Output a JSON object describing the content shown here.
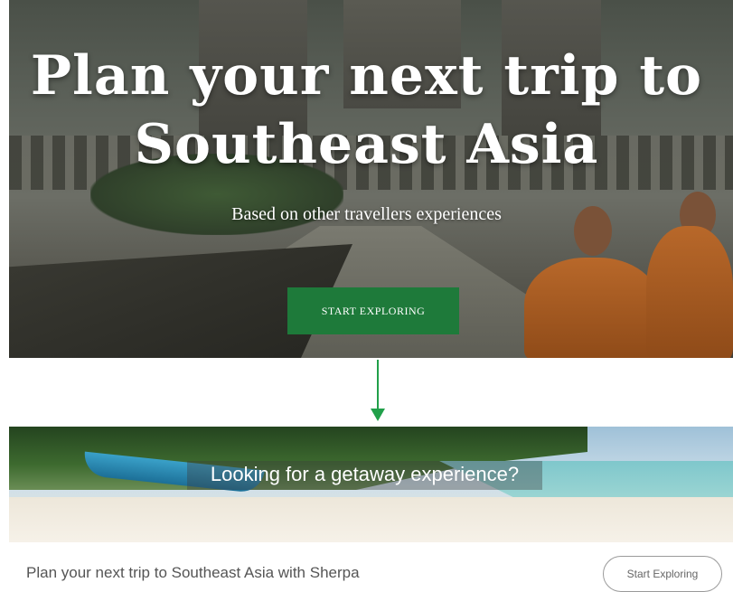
{
  "hero_top": {
    "title_line1": "Plan your next trip to",
    "title_line2": "Southeast Asia",
    "subtitle": "Based on other travellers experiences",
    "cta_label": "START EXPLORING"
  },
  "hero_bottom": {
    "banner_text": "Looking for a getaway experience?"
  },
  "footer": {
    "text": "Plan your next trip to Southeast Asia with Sherpa",
    "cta_label": "Start Exploring"
  },
  "colors": {
    "primary_button": "#1e7a3a",
    "arrow": "#21a04a"
  }
}
